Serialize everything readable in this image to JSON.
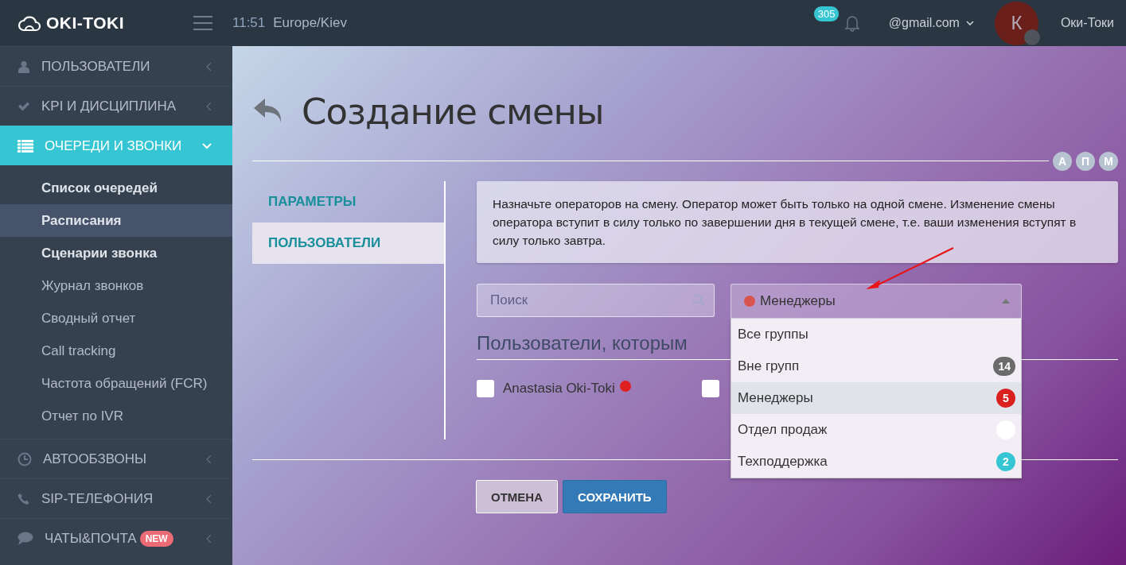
{
  "header": {
    "logo": "OKI-TOKI",
    "time": "11:51",
    "timezone": "Europe/Kiev",
    "notifications": "305",
    "email": "@gmail.com",
    "avatar": "К",
    "user_name": "Оки-Токи"
  },
  "sidebar": {
    "items": [
      {
        "kind": "section",
        "label": "ПОЛЬЗОВАТЕЛИ",
        "expanded": false
      },
      {
        "kind": "section",
        "label": "KPI И ДИСЦИПЛИНА",
        "expanded": false
      },
      {
        "kind": "section",
        "label": "ОЧЕРЕДИ И ЗВОНКИ",
        "expanded": true,
        "children": [
          {
            "kind": "group",
            "label": "Список очередей",
            "selected": false
          },
          {
            "kind": "group",
            "label": "Расписания",
            "selected": true
          },
          {
            "kind": "group",
            "label": "Сценарии звонка",
            "selected": false
          },
          {
            "kind": "link",
            "label": "Журнал звонков",
            "selected": false
          },
          {
            "kind": "link",
            "label": "Сводный отчет",
            "selected": false
          },
          {
            "kind": "link",
            "label": "Call tracking",
            "selected": false
          },
          {
            "kind": "link",
            "label": "Частота обращений (FCR)",
            "selected": false
          },
          {
            "kind": "link",
            "label": "Отчет по IVR",
            "selected": false
          }
        ]
      },
      {
        "kind": "section",
        "label": "АВТООБЗВОНЫ",
        "expanded": false
      },
      {
        "kind": "section",
        "label": "SIP-ТЕЛЕФОНИЯ",
        "expanded": false
      },
      {
        "kind": "section",
        "label": "ЧАТЫ&ПОЧТА",
        "badge": "NEW",
        "expanded": false
      }
    ]
  },
  "page": {
    "title": "Создание смены",
    "mode_buttons": [
      "А",
      "П",
      "М"
    ],
    "tabs": [
      {
        "label": "ПАРАМЕТРЫ",
        "selected": false
      },
      {
        "label": "ПОЛЬЗОВАТЕЛИ",
        "selected": true
      }
    ],
    "info": "Назначьте операторов на смену. Оператор может быть только на одной смене. Изменение смены оператора вступит в силу только по завершении дня в текущей смене, т.е. ваши изменения вступят в силу только завтра.",
    "search": {
      "placeholder": "Поиск"
    },
    "group_select": {
      "value": "Менеджеры",
      "color": "#d9534f",
      "expanded": true,
      "options": [
        {
          "label": "Все группы",
          "selected": false
        },
        {
          "label": "Вне групп",
          "count": "14",
          "color": "#6b6b6b",
          "selected": false
        },
        {
          "label": "Менеджеры",
          "count": "5",
          "color": "#d9201f",
          "selected": true
        },
        {
          "label": "Отдел продаж",
          "color": "#ffffff",
          "selected": false
        },
        {
          "label": "Техподдержка",
          "count": "2",
          "color": "#36c6d3",
          "selected": false
        }
      ]
    },
    "users_heading": "Пользователи, которым",
    "users": [
      {
        "name": "Anastasia Oki-Toki",
        "color": "#e02020",
        "checked": false
      },
      {
        "checked": false
      }
    ],
    "buttons": [
      {
        "kind": "cancel",
        "label": "ОТМЕНА"
      },
      {
        "kind": "save",
        "label": "СОХРАНИТЬ"
      }
    ]
  }
}
